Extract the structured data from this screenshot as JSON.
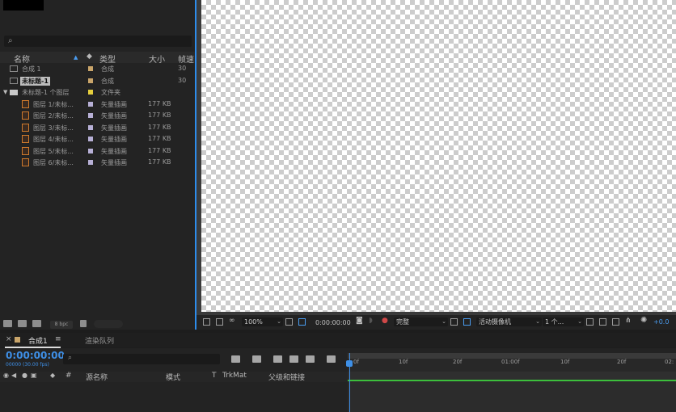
{
  "project": {
    "search_icon": "⌕",
    "headers": {
      "name": "名称",
      "type": "类型",
      "size": "大小",
      "fps": "帧速"
    },
    "items": [
      {
        "name": "合成 1",
        "type": "合成",
        "size": "",
        "fps": "30",
        "color": "#c9a56a",
        "selected": false
      },
      {
        "name": "未标题-1",
        "type": "合成",
        "size": "",
        "fps": "30",
        "color": "#c9a56a",
        "selected": true
      },
      {
        "name": "未标题-1 个图层",
        "type": "文件夹",
        "size": "",
        "fps": "",
        "color": "#e6cf3d",
        "selected": false
      },
      {
        "name": "图层 1/未标...",
        "type": "矢量插画",
        "size": "177 KB",
        "fps": "",
        "color": "#b7b0d6",
        "selected": false
      },
      {
        "name": "图层 2/未标...",
        "type": "矢量插画",
        "size": "177 KB",
        "fps": "",
        "color": "#b7b0d6",
        "selected": false
      },
      {
        "name": "图层 3/未标...",
        "type": "矢量插画",
        "size": "177 KB",
        "fps": "",
        "color": "#b7b0d6",
        "selected": false
      },
      {
        "name": "图层 4/未标...",
        "type": "矢量插画",
        "size": "177 KB",
        "fps": "",
        "color": "#b7b0d6",
        "selected": false
      },
      {
        "name": "图层 5/未标...",
        "type": "矢量插画",
        "size": "177 KB",
        "fps": "",
        "color": "#b7b0d6",
        "selected": false
      },
      {
        "name": "图层 6/未标...",
        "type": "矢量插画",
        "size": "177 KB",
        "fps": "",
        "color": "#b7b0d6",
        "selected": false
      }
    ],
    "bpc": "8 bpc"
  },
  "viewer": {
    "zoom": "100%",
    "timecode": "0:00:00:00",
    "resolution": "完整",
    "camera": "活动摄像机",
    "views": "1 个...",
    "exposure": "+0.0"
  },
  "timeline": {
    "close": "×",
    "tab_comp": "合成1",
    "tab_menu": "≡",
    "tab_render": "渲染队列",
    "timecode": "0:00:00:00",
    "fps_label": "00000 (30.00 fps)",
    "search_icon": "⌕",
    "layer_headers": {
      "source": "源名称",
      "mode": "模式",
      "t": "T",
      "trkmat": "TrkMat",
      "parent": "父级和链接",
      "hash": "#"
    },
    "ruler": [
      "0f",
      "10f",
      "20f",
      "01:00f",
      "10f",
      "20f",
      "02:"
    ]
  },
  "colors": {
    "accent": "#3e8fe6",
    "work_area_green": "#3cbf3c"
  }
}
